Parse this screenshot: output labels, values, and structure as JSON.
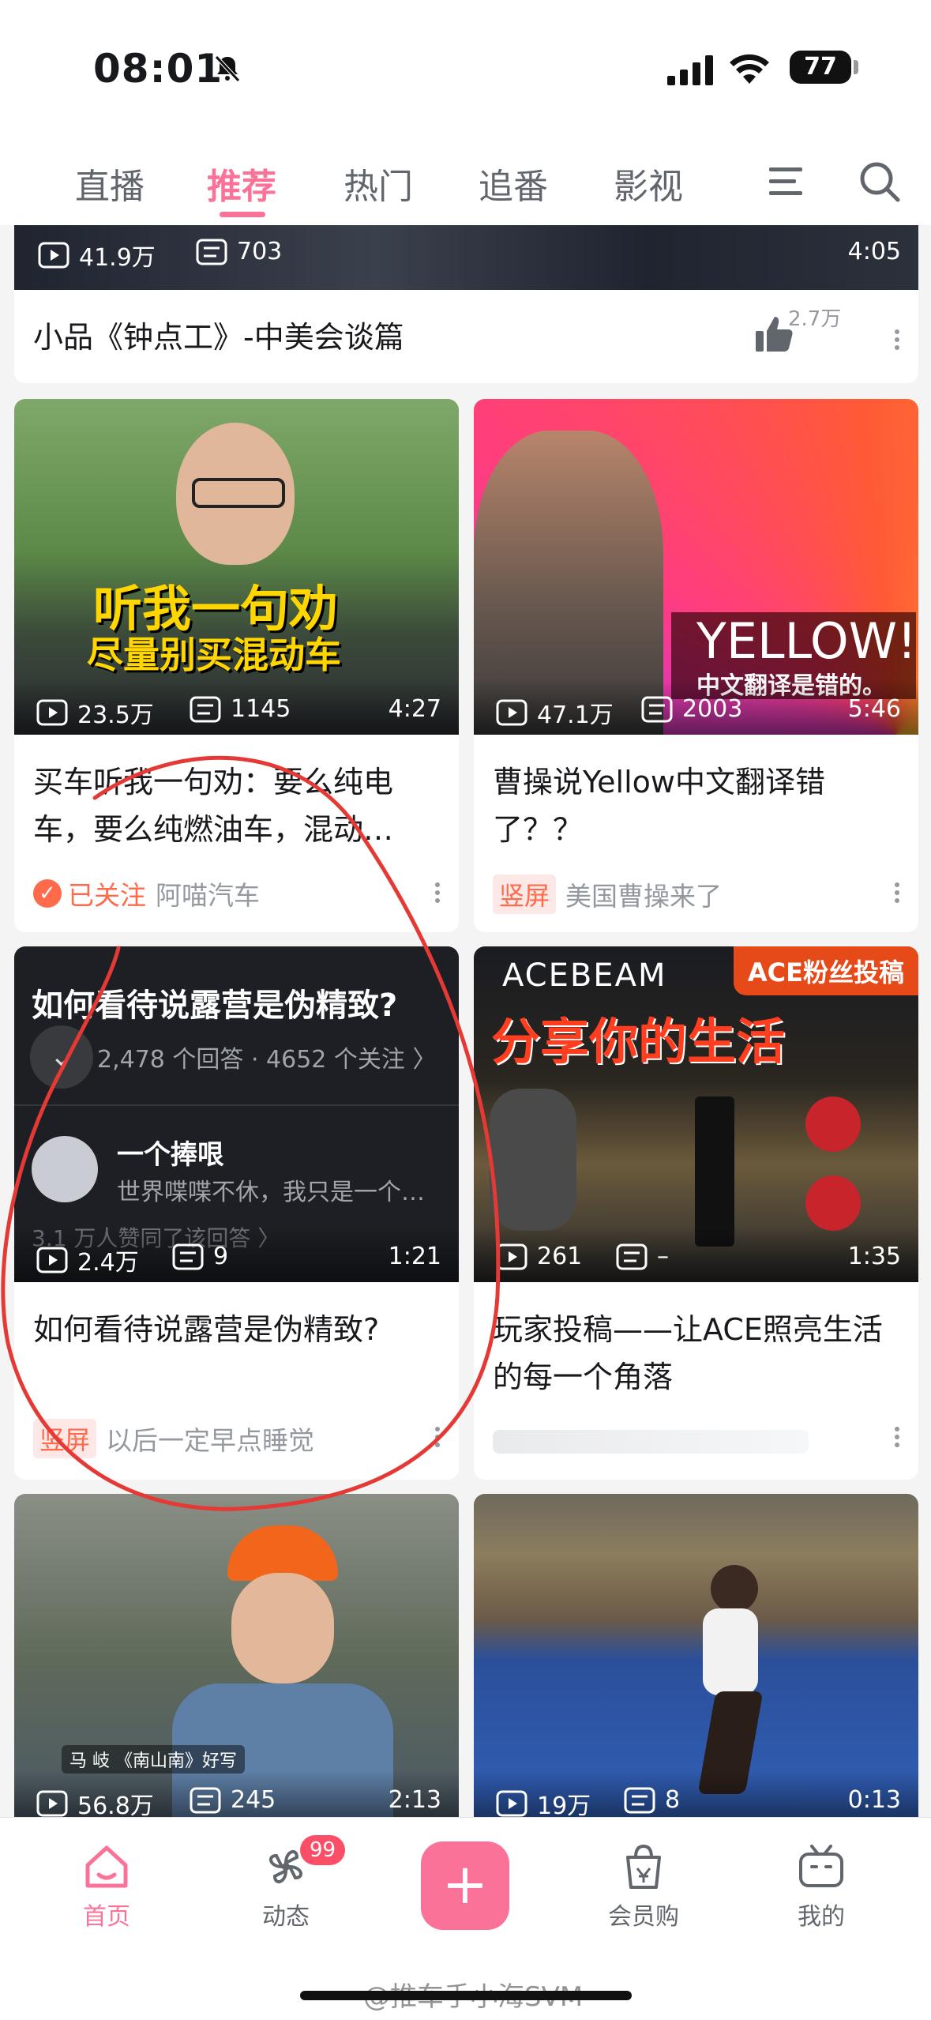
{
  "status_bar": {
    "time": "08:01",
    "battery": "77"
  },
  "tabs": [
    {
      "label": "直播"
    },
    {
      "label": "推荐"
    },
    {
      "label": "热门"
    },
    {
      "label": "追番"
    },
    {
      "label": "影视"
    }
  ],
  "cards": {
    "top": {
      "views": "41.9万",
      "comments": "703",
      "duration": "4:05",
      "title": "小品《钟点工》-中美会谈篇",
      "likes": "2.7万"
    },
    "c1": {
      "overlay_line1": "听我一句劝",
      "overlay_line2": "尽量别买混动车",
      "views": "23.5万",
      "comments": "1145",
      "duration": "4:27",
      "title": "买车听我一句劝：要么纯电车，要么纯燃油车，混动…",
      "followed_label": "已关注",
      "uploader": "阿喵汽车"
    },
    "c2": {
      "overlay_text": "YELLOW!",
      "overlay_sub": "中文翻译是错的。",
      "views": "47.1万",
      "comments": "2003",
      "duration": "5:46",
      "title": "曹操说Yellow中文翻译错了？？",
      "tag": "竖屏",
      "uploader": "美国曹操来了"
    },
    "c3": {
      "question": "如何看待说露营是伪精致?",
      "answers": "2,478 个回答 · 4652 个关注 〉",
      "author": "一个捧哏",
      "excerpt": "世界喋喋不休，我只是一个…",
      "likes_text": "3.1 万人赞同了该回答 〉",
      "views": "2.4万",
      "comments": "9",
      "duration": "1:21",
      "title": "如何看待说露营是伪精致?",
      "tag": "竖屏",
      "uploader": "以后一定早点睡觉"
    },
    "c4": {
      "brand": "ACEBEAM",
      "badge": "ACE粉丝投稿",
      "headline": "分享你的生活",
      "views": "261",
      "comments": "–",
      "duration": "1:35",
      "title": "玩家投稿——让ACE照亮生活的每一个角落"
    },
    "c5": {
      "caption": "马 岐  《南山南》好写",
      "views": "56.8万",
      "comments": "245",
      "duration": "2:13"
    },
    "c6": {
      "views": "19万",
      "comments": "8",
      "duration": "0:13"
    }
  },
  "bottom_nav": {
    "home": "首页",
    "dynamic": "动态",
    "dynamic_badge": "99",
    "plus": "+",
    "shop": "会员购",
    "mine": "我的"
  },
  "watermark": "@推车手小海SVM",
  "colors": {
    "accent": "#fb7299",
    "annotation": "#e53935",
    "tag": "#ff6b4a"
  }
}
